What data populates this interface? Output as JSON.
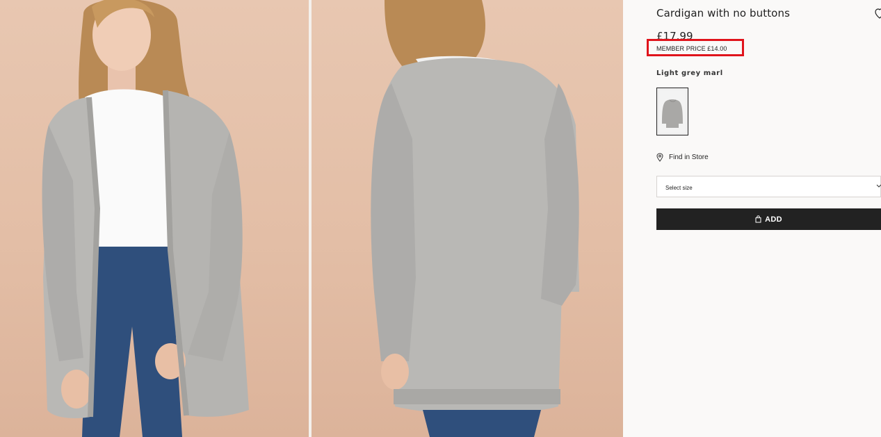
{
  "product": {
    "title": "Cardigan with no buttons",
    "price": "£17.99",
    "member_price": "MEMBER PRICE £14.00",
    "color_name": "Light grey marl",
    "find_in_store": "Find in Store",
    "select_size_placeholder": "Select size",
    "add_label": "ADD"
  },
  "colors": {
    "highlight": "#e0141c",
    "add_button": "#222222",
    "photo_background": "#e3bea6",
    "cardigan": "#b9b8b5"
  },
  "icons": {
    "favourite": "heart-icon",
    "find_in_store": "location-pin-icon",
    "select_size": "chevron-down-icon",
    "add": "shopping-bag-icon"
  }
}
